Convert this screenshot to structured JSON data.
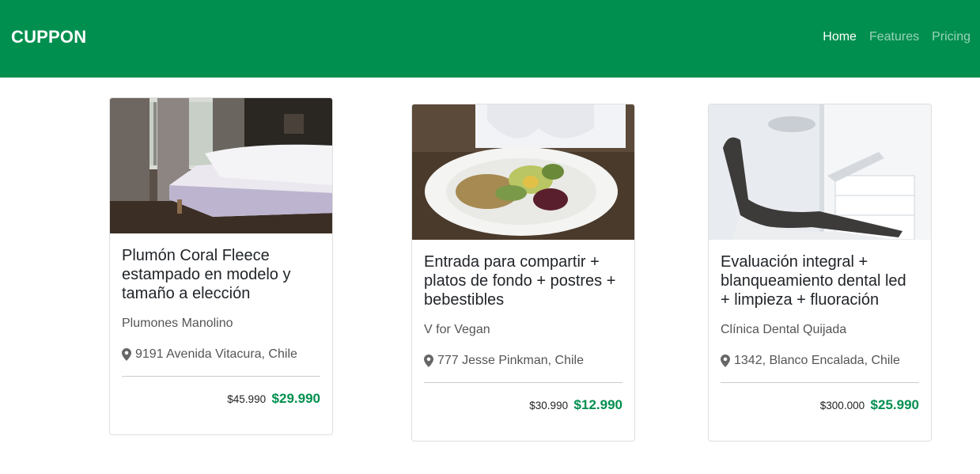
{
  "navbar": {
    "brand": "CUPPON",
    "links": [
      {
        "label": "Home"
      },
      {
        "label": "Features"
      },
      {
        "label": "Pricing"
      }
    ]
  },
  "colors": {
    "brand_green": "#008f4f"
  },
  "cards": [
    {
      "title": "Plumón Coral Fleece estampado en modelo y tamaño a elección",
      "company": "Plumones Manolino",
      "location": "9191 Avenida Vitacura, Chile",
      "old_price": "$45.990",
      "new_price": "$29.990",
      "image": "bedroom-photo"
    },
    {
      "title": "Entrada para compartir + platos de fondo + postres + bebestibles",
      "company": "V for Vegan",
      "location": "777 Jesse Pinkman, Chile",
      "old_price": "$30.990",
      "new_price": "$12.990",
      "image": "vegan-salad-photo"
    },
    {
      "title": "Evaluación integral + blanqueamiento dental led + limpieza + fluoración",
      "company": "Clínica Dental Quijada",
      "location": "1342, Blanco Encalada, Chile",
      "old_price": "$300.000",
      "new_price": "$25.990",
      "image": "dental-chair-photo"
    }
  ]
}
